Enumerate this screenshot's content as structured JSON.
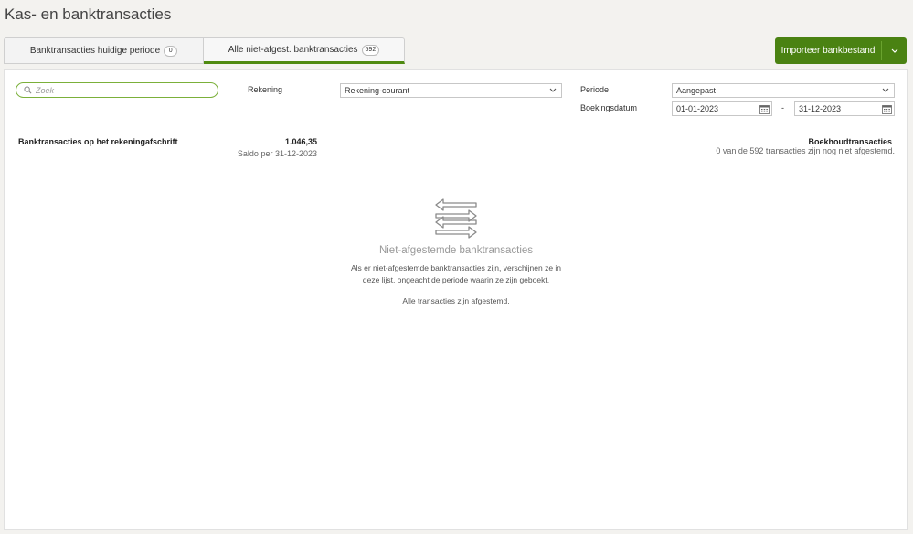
{
  "page": {
    "title": "Kas- en banktransacties"
  },
  "tabs": [
    {
      "label": "Banktransacties huidige periode",
      "count": "0"
    },
    {
      "label": "Alle niet-afgest. banktransacties",
      "count": "592",
      "active": true
    }
  ],
  "import_button": {
    "label": "Importeer bankbestand",
    "caret": "⌄"
  },
  "filters": {
    "search_placeholder": "Zoek",
    "account_label": "Rekening",
    "account_value": "Rekening-courant",
    "period_label": "Periode",
    "period_value": "Aangepast",
    "booking_date_label": "Boekingsdatum",
    "date_from": "01-01-2023",
    "date_separator": "-",
    "date_to": "31-12-2023"
  },
  "bank_statement": {
    "title": "Banktransacties op het rekeningafschrift",
    "amount": "1.046,35",
    "saldo": "Saldo per 31-12-2023"
  },
  "bookkeeping": {
    "title": "Boekhoudtransacties",
    "subtitle": "0 van de 592 transacties zijn nog niet afgestemd."
  },
  "empty_state": {
    "icon": "transfer-arrows-icon",
    "title": "Niet-afgestemde banktransacties",
    "text": "Als er niet-afgestemde banktransacties zijn, verschijnen ze in deze lijst, ongeacht de periode waarin ze zijn geboekt.",
    "done": "Alle transacties zijn afgestemd."
  },
  "colors": {
    "accent": "#4a8212",
    "search_border": "#7bb03a",
    "background": "#f3f2ef"
  }
}
